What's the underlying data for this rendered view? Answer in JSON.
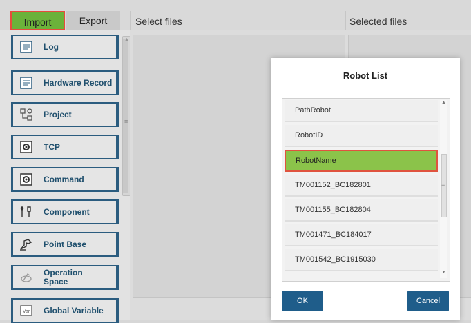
{
  "tabs": {
    "import": "Import",
    "export": "Export"
  },
  "columns": {
    "select_files": "Select files",
    "selected_files": "Selected files"
  },
  "sidebar": {
    "items": [
      {
        "label": "Log",
        "icon": "log-icon"
      },
      {
        "label": "Hardware Record",
        "icon": "record-icon"
      },
      {
        "label": "Project",
        "icon": "project-icon"
      },
      {
        "label": "TCP",
        "icon": "tcp-icon"
      },
      {
        "label": "Command",
        "icon": "command-icon"
      },
      {
        "label": "Component",
        "icon": "component-icon"
      },
      {
        "label": "Point Base",
        "icon": "point-base-icon"
      },
      {
        "label": "Operation Space",
        "icon": "operation-space-icon"
      },
      {
        "label": "Global Variable",
        "icon": "global-variable-icon"
      }
    ]
  },
  "dialog": {
    "title": "Robot List",
    "items": [
      "PathRobot",
      "RobotID",
      "RobotName",
      "TM001152_BC182801",
      "TM001155_BC182804",
      "TM001471_BC184017",
      "TM001542_BC1915030"
    ],
    "selected": "RobotName",
    "ok": "OK",
    "cancel": "Cancel"
  },
  "colors": {
    "accent_green": "#8bc34a",
    "highlight_border": "#e0533f",
    "button_blue": "#1f5d8a",
    "sidebar_text": "#1f4f6d"
  }
}
